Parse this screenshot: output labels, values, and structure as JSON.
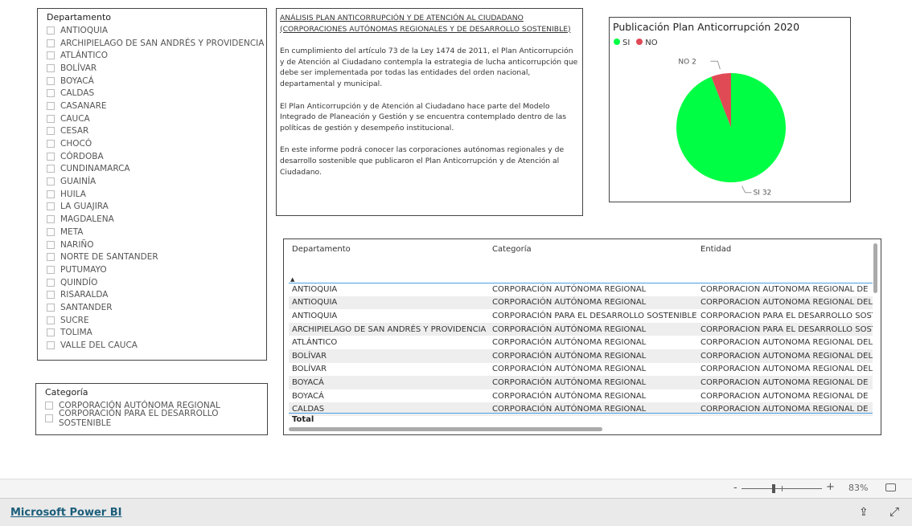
{
  "departamento_slicer": {
    "title": "Departamento",
    "items": [
      "ANTIOQUIA",
      "ARCHIPIELAGO DE SAN ANDRÉS Y PROVIDENCIA",
      "ATLÁNTICO",
      "BOLÍVAR",
      "BOYACÁ",
      "CALDAS",
      "CASANARE",
      "CAUCA",
      "CESAR",
      "CHOCÓ",
      "CÓRDOBA",
      "CUNDINAMARCA",
      "GUAINÍA",
      "HUILA",
      "LA GUAJIRA",
      "MAGDALENA",
      "META",
      "NARIÑO",
      "NORTE DE SANTANDER",
      "PUTUMAYO",
      "QUINDÍO",
      "RISARALDA",
      "SANTANDER",
      "SUCRE",
      "TOLIMA",
      "VALLE DEL CAUCA"
    ]
  },
  "categoria_slicer": {
    "title": "Categoría",
    "items": [
      "CORPORACIÓN AUTÓNOMA REGIONAL",
      "CORPORACIÓN PARA EL DESARROLLO SOSTENIBLE"
    ]
  },
  "textbox": {
    "title": "ANÁLISIS PLAN ANTICORRUPCIÓN Y DE ATENCIÓN AL CIUDADANO (CORPORACIONES AUTÓNOMAS REGIONALES Y DE DESARROLLO SOSTENIBLE)",
    "paragraphs": [
      "En cumplimiento del artículo 73 de la Ley 1474 de 2011, el Plan Anticorrupción y de Atención al Ciudadano contempla la estrategia de lucha anticorrupción que debe ser implementada por todas las entidades del orden nacional, departamental y municipal.",
      "El Plan Anticorrupción y de Atención al Ciudadano hace parte del Modelo Integrado de Planeación y Gestión y se encuentra contemplado dentro de las políticas de gestión y desempeño institucional.",
      "En este informe podrá conocer las corporaciones autónomas regionales y de desarrollo sostenible que publicaron el Plan Anticorrupción y de Atención al Ciudadano."
    ]
  },
  "chart_data": {
    "type": "pie",
    "title": "Publicación Plan Anticorrupción 2020",
    "legend_position": "top-left",
    "slices": [
      {
        "label": "SI",
        "value": 32,
        "color": "#00ff44",
        "data_label": "SI 32"
      },
      {
        "label": "NO",
        "value": 2,
        "color": "#e04a55",
        "data_label": "NO 2"
      }
    ]
  },
  "table": {
    "columns": [
      "Departamento",
      "Categoría",
      "Entidad"
    ],
    "sort_indicator": "▲",
    "rows": [
      [
        "ANTIOQUIA",
        "CORPORACIÓN AUTÓNOMA REGIONAL",
        "CORPORACION AUTONOMA REGIONAL DE"
      ],
      [
        "ANTIOQUIA",
        "CORPORACIÓN AUTÓNOMA REGIONAL",
        "CORPORACION AUTONOMA REGIONAL DEL"
      ],
      [
        "ANTIOQUIA",
        "CORPORACIÓN PARA EL DESARROLLO SOSTENIBLE",
        "CORPORACION PARA EL DESARROLLO SOST"
      ],
      [
        "ARCHIPIELAGO DE SAN ANDRÉS Y PROVIDENCIA",
        "CORPORACIÓN AUTÓNOMA REGIONAL",
        "CORPORACION PARA EL DESARROLLO SOST"
      ],
      [
        "ATLÁNTICO",
        "CORPORACIÓN AUTÓNOMA REGIONAL",
        "CORPORACION AUTONOMA REGIONAL DEL"
      ],
      [
        "BOLÍVAR",
        "CORPORACIÓN AUTÓNOMA REGIONAL",
        "CORPORACION AUTONOMA REGIONAL DEL"
      ],
      [
        "BOLÍVAR",
        "CORPORACIÓN AUTÓNOMA REGIONAL",
        "CORPORACION AUTONOMA REGIONAL DEL"
      ],
      [
        "BOYACÁ",
        "CORPORACIÓN AUTÓNOMA REGIONAL",
        "CORPORACION AUTONOMA REGIONAL DE"
      ],
      [
        "BOYACÁ",
        "CORPORACIÓN AUTÓNOMA REGIONAL",
        "CORPORACION AUTONOMA REGIONAL DE"
      ],
      [
        "CALDAS",
        "CORPORACIÓN AUTÓNOMA REGIONAL",
        "CORPORACION AUTONOMA REGIONAL DE"
      ]
    ],
    "total_label": "Total"
  },
  "footer": {
    "zoom_minus": "-",
    "zoom_plus": "+",
    "zoom_level": "83%",
    "zoom_fraction": 0.4,
    "brand": "Microsoft Power BI"
  }
}
